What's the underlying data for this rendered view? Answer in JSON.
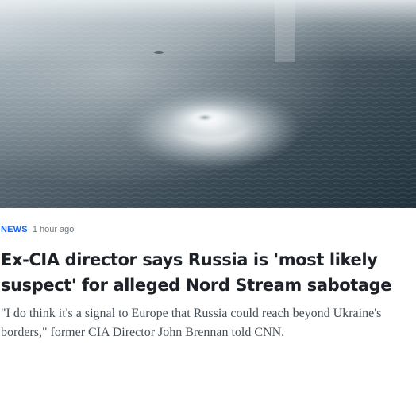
{
  "article": {
    "image_alt": "Aerial view of gas bubbling up on the surface of the Baltic Sea",
    "category": "NEWS",
    "timestamp": "1 hour ago",
    "headline": "Ex-CIA director says Russia is 'most likely suspect' for alleged Nord Stream sabotage",
    "summary": "\"I do think it's a signal to Europe that Russia could reach beyond Ukraine's borders,\" former CIA Director John Brennan told CNN."
  },
  "colors": {
    "category": "#0f69ff",
    "headline": "#1d2228",
    "summary": "#464e56",
    "timestamp": "#6e7780",
    "sea_dark": "#1f3440",
    "sea_light": "#8fa0aa",
    "foam": "#ffffff"
  }
}
